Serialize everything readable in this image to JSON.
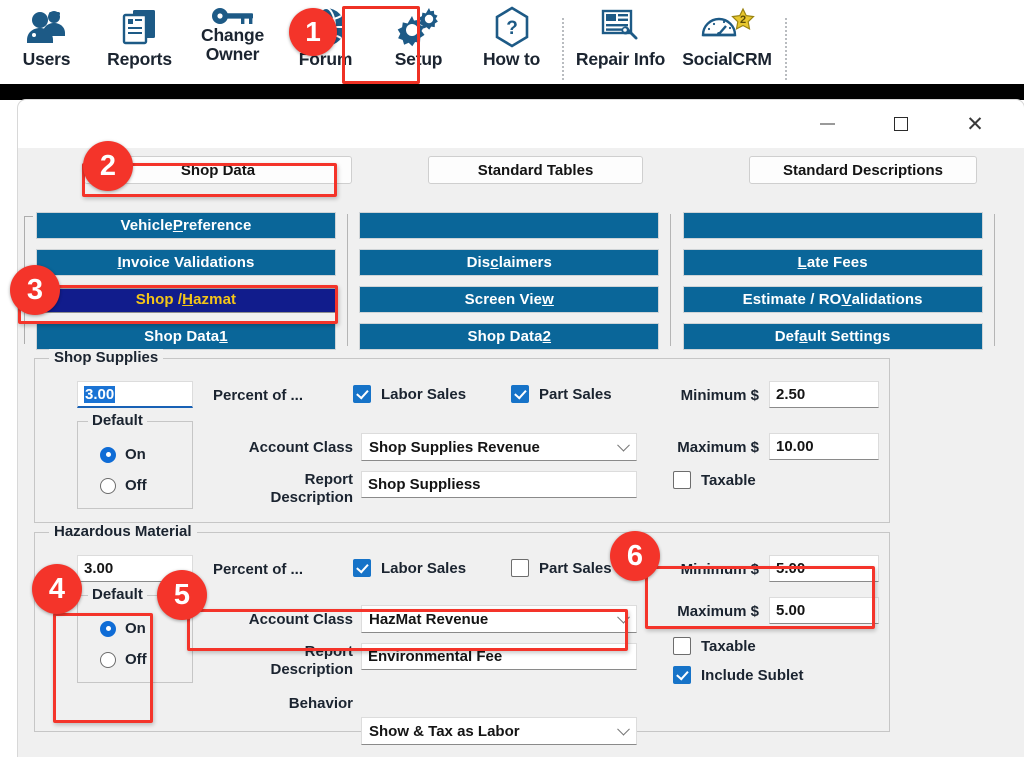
{
  "toolbar": {
    "items": [
      {
        "label": "Users",
        "icon": "users-icon"
      },
      {
        "label": "Reports",
        "icon": "reports-icon"
      },
      {
        "label_line1": "Change",
        "label_line2": "Owner",
        "icon": "key-icon"
      },
      {
        "label": "Forum",
        "icon": "globe-icon"
      },
      {
        "label": "Setup",
        "icon": "gears-icon"
      },
      {
        "label": "How to",
        "icon": "question-icon"
      },
      {
        "label": "Repair Info",
        "icon": "repair-document-icon"
      },
      {
        "label": "SocialCRM",
        "icon": "gauge-icon",
        "badge": "2"
      }
    ]
  },
  "window": {
    "controls": {
      "minimize": "minimize-icon",
      "maximize": "maximize-icon",
      "close": "✕"
    }
  },
  "tabs": [
    {
      "label": "Shop Data",
      "selected": true
    },
    {
      "label": "Standard Tables",
      "selected": false
    },
    {
      "label": "Standard Descriptions",
      "selected": false
    }
  ],
  "nav": {
    "column1": [
      {
        "label": "Vehicle Preference",
        "accel": "P",
        "active": false
      },
      {
        "label": "Invoice Validations",
        "accel": "I",
        "active": false
      },
      {
        "label": "Shop / Hazmat",
        "accel": "H",
        "active": true
      },
      {
        "label": "Shop Data 1",
        "accel": "1",
        "active": false
      }
    ],
    "column2": [
      {
        "label": "",
        "accel": "",
        "active": false
      },
      {
        "label": "Disclaimers",
        "accel": "c",
        "active": false
      },
      {
        "label": "Screen View",
        "accel": "w",
        "active": false
      },
      {
        "label": "Shop Data 2",
        "accel": "2",
        "active": false
      }
    ],
    "column3": [
      {
        "label": "",
        "accel": "",
        "active": false
      },
      {
        "label": "Late Fees",
        "accel": "L",
        "active": false
      },
      {
        "label": "Estimate / RO Validations",
        "accel": "V",
        "active": false
      },
      {
        "label": "Default Settings",
        "accel": "a",
        "active": false
      }
    ]
  },
  "shop_supplies": {
    "legend": "Shop Supplies",
    "percent_value": "3.00",
    "percent_label": "Percent of ...",
    "default_legend": "Default",
    "radio_on_label": "On",
    "radio_off_label": "Off",
    "default_selected": "On",
    "labor_sales_label": "Labor Sales",
    "labor_sales_checked": true,
    "part_sales_label": "Part Sales",
    "part_sales_checked": true,
    "account_class_label": "Account Class",
    "account_class_value": "Shop Supplies Revenue",
    "report_description_label_1": "Report",
    "report_description_label_2": "Description",
    "report_description_value": "Shop Suppliess",
    "minimum_label": "Minimum $",
    "minimum_value": "2.50",
    "maximum_label": "Maximum $",
    "maximum_value": "10.00",
    "taxable_label": "Taxable",
    "taxable_checked": false
  },
  "hazmat": {
    "legend": "Hazardous Material",
    "percent_value": "3.00",
    "percent_label": "Percent of ...",
    "default_legend": "Default",
    "radio_on_label": "On",
    "radio_off_label": "Off",
    "default_selected": "On",
    "labor_sales_label": "Labor Sales",
    "labor_sales_checked": true,
    "part_sales_label": "Part Sales",
    "part_sales_checked": false,
    "account_class_label": "Account Class",
    "account_class_value": "HazMat Revenue",
    "report_description_label_1": "Report",
    "report_description_label_2": "Description",
    "report_description_value": "Environmental Fee",
    "behavior_label": "Behavior",
    "behavior_value": "Show & Tax as Labor",
    "minimum_label": "Minimum $",
    "minimum_value": "5.00",
    "maximum_label": "Maximum $",
    "maximum_value": "5.00",
    "taxable_label": "Taxable",
    "taxable_checked": false,
    "include_sublet_label": "Include Sublet",
    "include_sublet_checked": true
  },
  "annotations": {
    "badges": [
      "1",
      "2",
      "3",
      "4",
      "5",
      "6"
    ]
  },
  "colors": {
    "accent_blue": "#0a6699",
    "active_nav": "#111c8c",
    "active_nav_text": "#f4c518",
    "annotation_red": "#f4342a",
    "checkbox_blue": "#1673c8",
    "toolbar_icon": "#1d5a86",
    "star_yellow": "#e8c72e"
  }
}
